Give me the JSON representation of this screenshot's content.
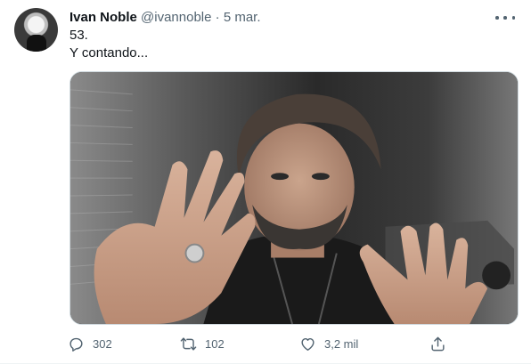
{
  "tweet": {
    "author_name": "Ivan Noble",
    "handle": "@ivannoble",
    "separator": " · ",
    "date": "5 mar.",
    "text_lines": [
      "53.",
      "Y contando..."
    ]
  },
  "actions": {
    "reply_count": "302",
    "retweet_count": "102",
    "like_count": "3,2 mil"
  },
  "icons": {
    "reply": "reply-icon",
    "retweet": "retweet-icon",
    "like": "heart-icon",
    "share": "share-icon",
    "more": "more-icon"
  },
  "colors": {
    "text_primary": "#0f1419",
    "text_secondary": "#536471",
    "border": "#cfd9de"
  }
}
